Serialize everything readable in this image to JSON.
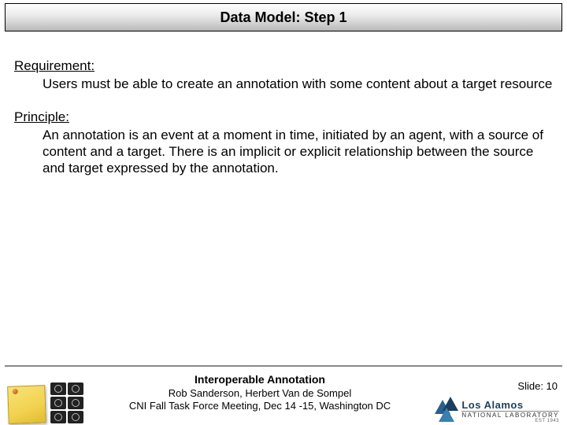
{
  "title": "Data Model: Step 1",
  "sections": [
    {
      "label": "Requirement:",
      "text": "Users must be able to create an annotation with some content about a target resource"
    },
    {
      "label": "Principle:",
      "text": "An annotation is an event at a moment in time, initiated by an agent, with a source of content and a target.  There is an implicit or explicit relationship between the source and target expressed by the annotation."
    }
  ],
  "footer": {
    "title": "Interoperable Annotation",
    "authors": "Rob Sanderson, Herbert Van de Sompel",
    "event": "CNI Fall Task Force Meeting, Dec 14 -15, Washington DC",
    "slide_label": "Slide: 10"
  },
  "logo": {
    "top": "Los Alamos",
    "bottom": "NATIONAL LABORATORY",
    "est": "EST 1943"
  }
}
